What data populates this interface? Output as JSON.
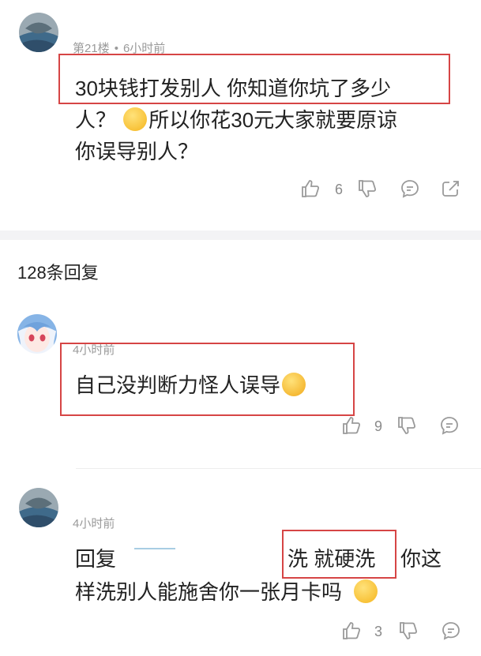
{
  "comment": {
    "floor": "第21楼",
    "separator": "•",
    "time": "6小时前",
    "lines": [
      "30块钱打发别人 你知道你坑了多少",
      "所以你花30元大家就要原谅",
      "你误导别人？"
    ],
    "line2_prefix": "人？",
    "like_count": "6"
  },
  "replies_header": {
    "count_label": "128条回复"
  },
  "reply1": {
    "time": "4小时前",
    "text": "自己没判断力怪人误导",
    "like_count": "9"
  },
  "reply2": {
    "time": "4小时前",
    "reply_prefix": "回复",
    "highlight": "洗 就硬洗",
    "line1_tail": "你这",
    "line2": "样洗别人能施舍你一张月卡吗",
    "like_count": "3"
  },
  "icons": {
    "like": "thumbs-up-icon",
    "dislike": "thumbs-down-icon",
    "reply": "comment-bubble-icon",
    "share": "share-icon"
  },
  "colors": {
    "highlight_border": "#d64545",
    "meta": "#9a9a9a",
    "divider": "#f3f3f5"
  }
}
